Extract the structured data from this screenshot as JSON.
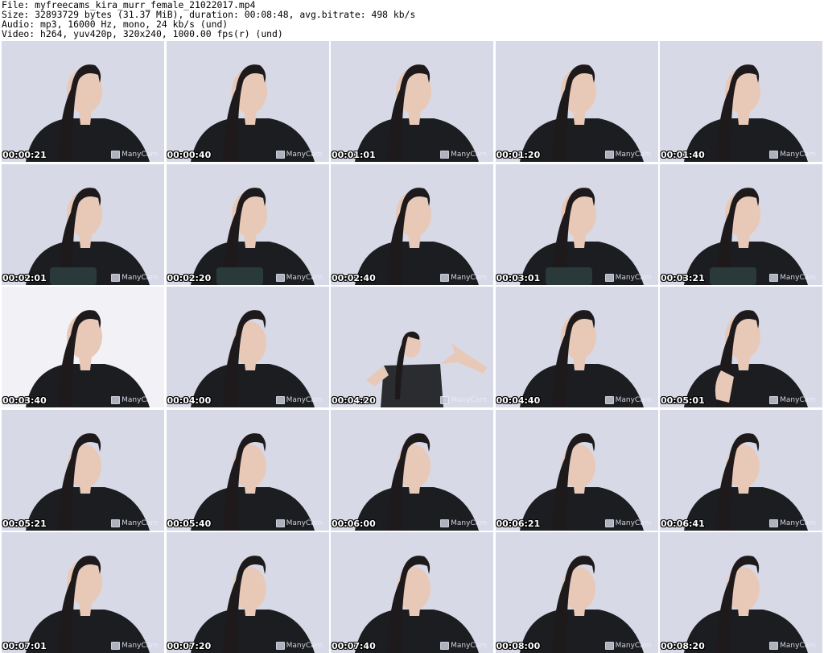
{
  "header": {
    "file": "File: myfreecams_kira_murr_female_21022017.mp4",
    "size": "Size: 32893729 bytes (31.37 MiB), duration: 00:08:48, avg.bitrate: 498 kb/s",
    "audio": "Audio: mp3, 16000 Hz, mono, 24 kb/s (und)",
    "video": "Video: h264, yuv420p, 320x240, 1000.00 fps(r) (und)"
  },
  "watermark": "ManyCam",
  "thumbnails": [
    {
      "time": "00:00:21"
    },
    {
      "time": "00:00:40"
    },
    {
      "time": "00:01:01"
    },
    {
      "time": "00:01:20"
    },
    {
      "time": "00:01:40"
    },
    {
      "time": "00:02:01"
    },
    {
      "time": "00:02:20"
    },
    {
      "time": "00:02:40"
    },
    {
      "time": "00:03:01"
    },
    {
      "time": "00:03:21"
    },
    {
      "time": "00:03:40"
    },
    {
      "time": "00:04:00"
    },
    {
      "time": "00:04:20"
    },
    {
      "time": "00:04:40"
    },
    {
      "time": "00:05:01"
    },
    {
      "time": "00:05:21"
    },
    {
      "time": "00:05:40"
    },
    {
      "time": "00:06:00"
    },
    {
      "time": "00:06:21"
    },
    {
      "time": "00:06:41"
    },
    {
      "time": "00:07:01"
    },
    {
      "time": "00:07:20"
    },
    {
      "time": "00:07:40"
    },
    {
      "time": "00:08:00"
    },
    {
      "time": "00:08:20"
    }
  ],
  "colors": {
    "wall": "#d7d9e6",
    "hair": "#1e1a1c",
    "shirt": "#1c1d20",
    "skin": "#e8c9b8",
    "timestamp": "#ffffff"
  }
}
